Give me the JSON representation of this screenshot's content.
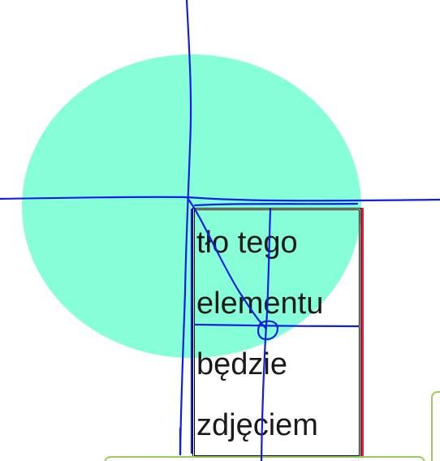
{
  "box_text": {
    "line_1": "tło tego",
    "line_2": "elementu",
    "line_3": "będzie",
    "line_4": "zdjęciem"
  },
  "colors": {
    "ellipse": "#86fed8",
    "annotation": "#1020e0",
    "box_accent": "#e0203a",
    "card_border": "#9ccb5a"
  }
}
